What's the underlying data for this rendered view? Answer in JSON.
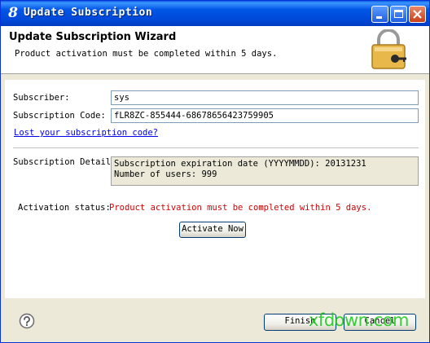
{
  "window": {
    "title": "Update Subscription",
    "app_icon_glyph": "8",
    "app_icon": "app-logo-icon",
    "controls": [
      "minimize-icon",
      "maximize-icon",
      "close-icon"
    ]
  },
  "banner": {
    "title": "Update Subscription Wizard",
    "description": "Product activation must be completed within 5 days.",
    "icon": "lock-key-icon"
  },
  "form": {
    "subscriber_label": "Subscriber:",
    "subscriber_value": "sys",
    "code_label": "Subscription Code:",
    "code_value": "fLR8ZC-855444-68678656423759905",
    "lost_code_link": "Lost your subscription code?",
    "detail_label": "Subscription Detail",
    "detail_lines": [
      "Subscription expiration date (YYYYMMDD): 20131231",
      "Number of users: 999"
    ],
    "status_label": "Activation status:",
    "status_value": "Product activation must be completed within 5 days.",
    "activate_button": "Activate Now"
  },
  "footer": {
    "help_icon": "help-icon",
    "finish_button": "Finish",
    "cancel_button": "Cancel",
    "watermark": "xfdown.com"
  },
  "colors": {
    "titlebar": "#0054e3",
    "dialog_bg": "#ece9d8",
    "status_red": "#d40000",
    "link_blue": "#0000ee",
    "watermark_green": "#16c816"
  }
}
